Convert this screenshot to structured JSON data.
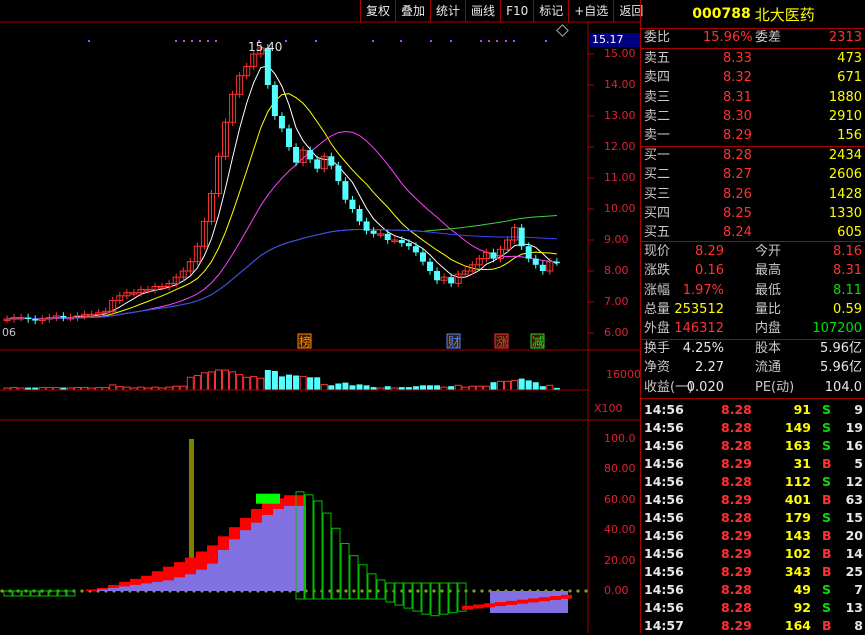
{
  "toolbar": {
    "buttons": [
      "复权",
      "叠加",
      "统计",
      "画线",
      "F10",
      "标记",
      "+自选",
      "返回"
    ]
  },
  "chart": {
    "current_price_tag": "15.17",
    "peak_label": "15.40",
    "price_axis": [
      "15.00",
      "14.00",
      "13.00",
      "12.00",
      "11.00",
      "10.00",
      "9.00",
      "8.00",
      "7.00",
      "6.00"
    ],
    "left_date": "06",
    "markers": [
      {
        "label": "榜",
        "color": "#ff8800"
      },
      {
        "label": "财",
        "color": "#4a8cff"
      },
      {
        "label": "涨",
        "color": "#ff3030"
      },
      {
        "label": "减",
        "color": "#30d030"
      }
    ],
    "volume_axis": [
      "16000"
    ],
    "volume_unit": "X100",
    "indicator_axis": [
      "100.0",
      "80.00",
      "60.00",
      "40.00",
      "20.00",
      "0.00"
    ]
  },
  "chart_data": {
    "type": "line",
    "title": "",
    "ylim": [
      6,
      15.5
    ],
    "candles_close": [
      6.45,
      6.5,
      6.5,
      6.45,
      6.4,
      6.45,
      6.5,
      6.55,
      6.5,
      6.5,
      6.55,
      6.6,
      6.6,
      6.65,
      6.7,
      7.05,
      7.2,
      7.3,
      7.3,
      7.4,
      7.4,
      7.5,
      7.5,
      7.6,
      7.8,
      8.0,
      8.3,
      8.8,
      9.6,
      10.5,
      11.7,
      12.8,
      13.7,
      14.3,
      14.6,
      15.0,
      15.2,
      14.0,
      13.0,
      12.6,
      12.0,
      11.5,
      11.9,
      11.6,
      11.3,
      11.7,
      11.4,
      10.9,
      10.3,
      10.0,
      9.6,
      9.3,
      9.2,
      9.2,
      9.0,
      9.0,
      8.9,
      8.8,
      8.6,
      8.3,
      8.0,
      7.7,
      7.8,
      7.6,
      7.9,
      8.0,
      8.2,
      8.4,
      8.6,
      8.4,
      8.7,
      9.0,
      9.4,
      8.8,
      8.4,
      8.2,
      8.0,
      8.3,
      8.29
    ]
  },
  "quote": {
    "code": "000788",
    "name": "北大医药",
    "wb_label": "委比",
    "wb_value": "15.96%",
    "wc_label": "委差",
    "wc_value": "2313",
    "asks": [
      {
        "label": "卖五",
        "price": "8.33",
        "vol": "473"
      },
      {
        "label": "卖四",
        "price": "8.32",
        "vol": "671"
      },
      {
        "label": "卖三",
        "price": "8.31",
        "vol": "1880"
      },
      {
        "label": "卖二",
        "price": "8.30",
        "vol": "2910"
      },
      {
        "label": "卖一",
        "price": "8.29",
        "vol": "156"
      }
    ],
    "bids": [
      {
        "label": "买一",
        "price": "8.28",
        "vol": "2434"
      },
      {
        "label": "买二",
        "price": "8.27",
        "vol": "2606"
      },
      {
        "label": "买三",
        "price": "8.26",
        "vol": "1428"
      },
      {
        "label": "买四",
        "price": "8.25",
        "vol": "1330"
      },
      {
        "label": "买五",
        "price": "8.24",
        "vol": "605"
      }
    ],
    "stats": [
      {
        "l1": "现价",
        "v1": "8.29",
        "l2": "今开",
        "v2": "8.16"
      },
      {
        "l1": "涨跌",
        "v1": "0.16",
        "l2": "最高",
        "v2": "8.31"
      },
      {
        "l1": "涨幅",
        "v1": "1.97%",
        "l2": "最低",
        "v2": "8.11"
      },
      {
        "l1": "总量",
        "v1": "253512",
        "l2": "量比",
        "v2": "0.59"
      },
      {
        "l1": "外盘",
        "v1": "146312",
        "l2": "内盘",
        "v2": "107200"
      }
    ],
    "stats2": [
      {
        "l1": "换手",
        "v1": "4.25%",
        "l2": "股本",
        "v2": "5.96亿"
      },
      {
        "l1": "净资",
        "v1": "2.27",
        "l2": "流通",
        "v2": "5.96亿"
      },
      {
        "l1": "收益(一)",
        "v1": "0.020",
        "l2": "PE(动)",
        "v2": "104.0"
      }
    ],
    "ticks": [
      {
        "t": "14:56",
        "p": "8.28",
        "v": "91",
        "d": "S",
        "n": "9"
      },
      {
        "t": "14:56",
        "p": "8.28",
        "v": "149",
        "d": "S",
        "n": "19"
      },
      {
        "t": "14:56",
        "p": "8.28",
        "v": "163",
        "d": "S",
        "n": "16"
      },
      {
        "t": "14:56",
        "p": "8.29",
        "v": "31",
        "d": "B",
        "n": "5"
      },
      {
        "t": "14:56",
        "p": "8.28",
        "v": "112",
        "d": "S",
        "n": "12"
      },
      {
        "t": "14:56",
        "p": "8.29",
        "v": "401",
        "d": "B",
        "n": "63"
      },
      {
        "t": "14:56",
        "p": "8.28",
        "v": "179",
        "d": "S",
        "n": "15"
      },
      {
        "t": "14:56",
        "p": "8.29",
        "v": "143",
        "d": "B",
        "n": "20"
      },
      {
        "t": "14:56",
        "p": "8.29",
        "v": "102",
        "d": "B",
        "n": "14"
      },
      {
        "t": "14:56",
        "p": "8.29",
        "v": "343",
        "d": "B",
        "n": "25"
      },
      {
        "t": "14:56",
        "p": "8.28",
        "v": "49",
        "d": "S",
        "n": "7"
      },
      {
        "t": "14:56",
        "p": "8.28",
        "v": "92",
        "d": "S",
        "n": "13"
      },
      {
        "t": "14:57",
        "p": "8.29",
        "v": "164",
        "d": "B",
        "n": "8"
      }
    ],
    "colors": {
      "up": "#ff3232",
      "down": "#00e000",
      "label": "#c8c8c8",
      "value": "#ffff00",
      "code": "#ffff00"
    }
  }
}
